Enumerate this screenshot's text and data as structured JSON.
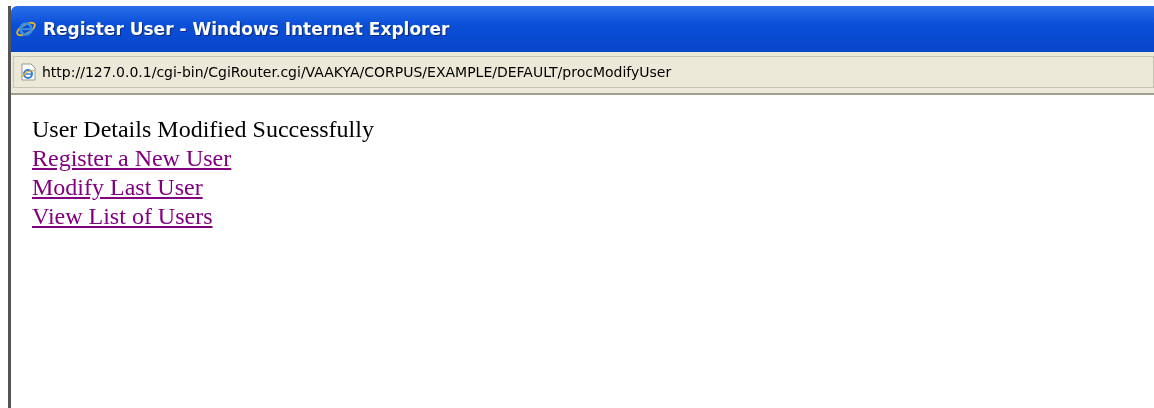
{
  "window": {
    "title": "Register User - Windows Internet Explorer"
  },
  "address_bar": {
    "url": "http://127.0.0.1/cgi-bin/CgiRouter.cgi/VAAKYA/CORPUS/EXAMPLE/DEFAULT/procModifyUser"
  },
  "page": {
    "message": "User Details Modified Successfully",
    "links": [
      {
        "label": "Register a New User",
        "visited": true
      },
      {
        "label": "Modify Last User",
        "visited": true
      },
      {
        "label": "View List of Users",
        "visited": true
      }
    ]
  }
}
